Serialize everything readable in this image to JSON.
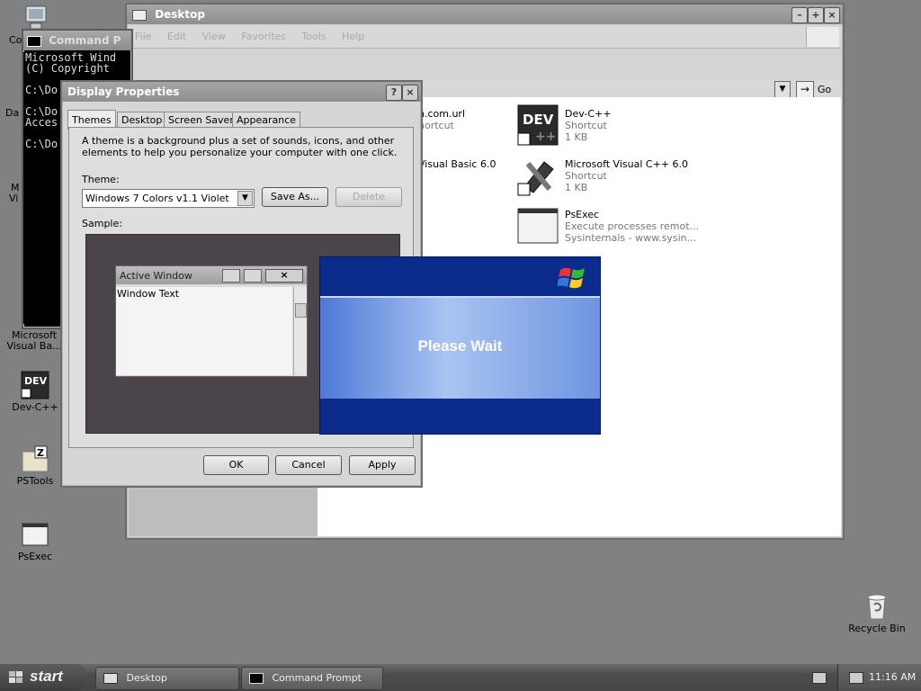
{
  "desktop_icons": [
    {
      "label": "Co",
      "icon": "computer-icon"
    },
    {
      "label": "Da",
      "icon": "folder-icon"
    },
    {
      "label": "M",
      "icon": "app-icon"
    },
    {
      "label": "Vi",
      "icon": "app-icon"
    },
    {
      "label": "Microsoft Visual Ba...",
      "icon": "visual-basic-icon"
    },
    {
      "label": "Dev-C++",
      "icon": "dev-cpp-icon"
    },
    {
      "label": "PSTools",
      "icon": "zip-folder-icon"
    },
    {
      "label": "PsExec",
      "icon": "window-app-icon"
    },
    {
      "label": "Recycle Bin",
      "icon": "recycle-bin-icon"
    }
  ],
  "explorer": {
    "title": "Desktop",
    "menu": [
      "File",
      "Edit",
      "View",
      "Favorites",
      "Tools",
      "Help"
    ],
    "go_label": "Go",
    "files": [
      {
        "name": "n.com.url",
        "line2": "hortcut",
        "line3": ""
      },
      {
        "name": "Visual Basic 6.0",
        "line2": "",
        "line3": ""
      },
      {
        "name": "Dev-C++",
        "line2": "Shortcut",
        "line3": "1 KB"
      },
      {
        "name": "Microsoft Visual C++ 6.0",
        "line2": "Shortcut",
        "line3": "1 KB"
      },
      {
        "name": "PsExec",
        "line2": "Execute processes remot...",
        "line3": "Sysinternals - www.sysin..."
      }
    ]
  },
  "console": {
    "title": "Command P",
    "lines": [
      "Microsoft Wind",
      "(C) Copyright",
      "",
      "C:\\Do",
      "",
      "C:\\Do",
      "Acces",
      "",
      "C:\\Do"
    ]
  },
  "dialog": {
    "title": "Display Properties",
    "tabs": [
      "Themes",
      "Desktop",
      "Screen Saver",
      "Appearance"
    ],
    "description": "A theme is a background plus a set of sounds, icons, and other elements to help you personalize your computer with one click.",
    "theme_label": "Theme:",
    "theme_value": "Windows 7 Colors v1.1 Violet",
    "save_as": "Save As...",
    "delete": "Delete",
    "sample_label": "Sample:",
    "sample_window_title": "Active Window",
    "sample_window_text": "Window Text",
    "ok": "OK",
    "cancel": "Cancel",
    "apply": "Apply"
  },
  "wait": {
    "message": "Please Wait"
  },
  "taskbar": {
    "start": "start",
    "tasks": [
      "Desktop",
      "Command Prompt"
    ],
    "clock": "11:16 AM"
  },
  "colors": {
    "xp_blue": "#0b2c8c",
    "wait_band": "#6f95e0"
  }
}
